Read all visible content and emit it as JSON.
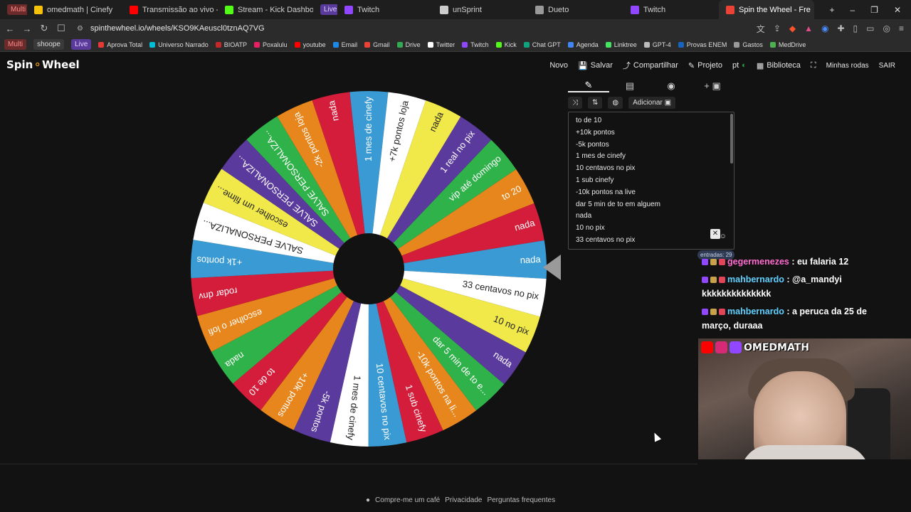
{
  "browser": {
    "tabs": [
      {
        "label": "Multi",
        "type": "pill"
      },
      {
        "label": "omedmath | Cinefy",
        "color": "#f4c20d"
      },
      {
        "label": "Transmissão ao vivo - YouTu",
        "color": "#ff0000"
      },
      {
        "label": "Stream - Kick Dashboard",
        "color": "#53fc18"
      },
      {
        "label": "Live",
        "type": "pill-purple"
      },
      {
        "label": "Twitch",
        "color": "#9146ff"
      },
      {
        "label": "unSprint",
        "color": "#cccccc"
      },
      {
        "label": "Dueto",
        "color": "#999999"
      },
      {
        "label": "Twitch",
        "color": "#9146ff"
      },
      {
        "label": "Spin the Wheel - Fre",
        "color": "#ea4335",
        "active": true
      }
    ],
    "url": "spinthewheel.io/wheels/KSO9KAeuscl0tznAQ7VG",
    "bookmarks": [
      "Aprova Total",
      "Universo Narrado",
      "BIOATP",
      "Poxalulu",
      "youtube",
      "Email",
      "Gmail",
      "Drive",
      "Twitter",
      "Twitch",
      "Kick",
      "Chat GPT",
      "Agenda",
      "Linktree",
      "GPT-4",
      "Provas ENEM",
      "Gastos",
      "MedDrive"
    ],
    "bookmark_pills": [
      "Multi",
      "shoope",
      "Live"
    ]
  },
  "app": {
    "logo_a": "Spin",
    "logo_o": "⚬",
    "logo_b": "Wheel",
    "menu": [
      "Novo",
      "Salvar",
      "Compartilhar",
      "Projeto",
      "pt",
      "Biblioteca"
    ],
    "my_wheels": "Minhas rodas",
    "exit": "SAIR",
    "add_image": "Adicionar",
    "entries_count_label": "entradas: 29",
    "entries": [
      "to de 10",
      "+10k pontos",
      "-5k pontos",
      "1 mes de cinefy",
      "10 centavos no pix",
      "1 sub cinefy",
      "-10k pontos na live",
      "dar 5 min de to em alguem",
      "nada",
      "10 no pix",
      "33 centavos no pix"
    ],
    "footer": [
      "Compre-me um café",
      "Privacidade",
      "Perguntas frequentes"
    ]
  },
  "wheel": {
    "slices": [
      {
        "label": "nada",
        "color": "#3a9bd4"
      },
      {
        "label": "33 centavos no pix",
        "color": "#ffffff"
      },
      {
        "label": "10 no pix",
        "color": "#f1e84a"
      },
      {
        "label": "nada",
        "color": "#5b3a9e"
      },
      {
        "label": "dar 5 min de to e...",
        "color": "#2fb24a"
      },
      {
        "label": "-10k pontos na li...",
        "color": "#e7861c"
      },
      {
        "label": "1 sub cinefy",
        "color": "#d41d3a"
      },
      {
        "label": "10 centavos no pix",
        "color": "#3a9bd4"
      },
      {
        "label": "1 mes de cinefy",
        "color": "#ffffff"
      },
      {
        "label": "-5k pontos",
        "color": "#5b3a9e"
      },
      {
        "label": "+10k pontos",
        "color": "#e7861c"
      },
      {
        "label": "to de 10",
        "color": "#d41d3a"
      },
      {
        "label": "nada",
        "color": "#2fb24a"
      },
      {
        "label": "escolher o lofi",
        "color": "#e7861c"
      },
      {
        "label": "rodar dnv",
        "color": "#d41d3a"
      },
      {
        "label": "+1k pontos",
        "color": "#3a9bd4"
      },
      {
        "label": "SALVE PERSONALIZA...",
        "color": "#ffffff"
      },
      {
        "label": "escolher um filme...",
        "color": "#f1e84a"
      },
      {
        "label": "SALVE PERSONALIZA...",
        "color": "#5b3a9e"
      },
      {
        "label": "SALVE PERSONALIZA...",
        "color": "#2fb24a"
      },
      {
        "label": "-2k pontos loja",
        "color": "#e7861c"
      },
      {
        "label": "nada",
        "color": "#d41d3a"
      },
      {
        "label": "1 mes de cinefy",
        "color": "#3a9bd4"
      },
      {
        "label": "+7k pontos loja",
        "color": "#ffffff"
      },
      {
        "label": "nada",
        "color": "#f1e84a"
      },
      {
        "label": "1 real no pix",
        "color": "#5b3a9e"
      },
      {
        "label": "vip até domingo",
        "color": "#2fb24a"
      },
      {
        "label": "to 20",
        "color": "#e7861c"
      },
      {
        "label": "nada",
        "color": "#d41d3a"
      }
    ]
  },
  "chat": [
    {
      "user": "gegermenezes",
      "user_color": "#ff6bd0",
      "text": " : eu falaria 12"
    },
    {
      "user": "mahbernardo",
      "user_color": "#5fd0ff",
      "text": " : @a_mandyi kkkkkkkkkkkkkk"
    },
    {
      "user": "mahbernardo",
      "user_color": "#5fd0ff",
      "text": " : a peruca da 25 de março, duraaa"
    }
  ],
  "stream_name": "OMEDMATH",
  "colors": {
    "accent": "#f4a11a",
    "background": "#121212"
  }
}
